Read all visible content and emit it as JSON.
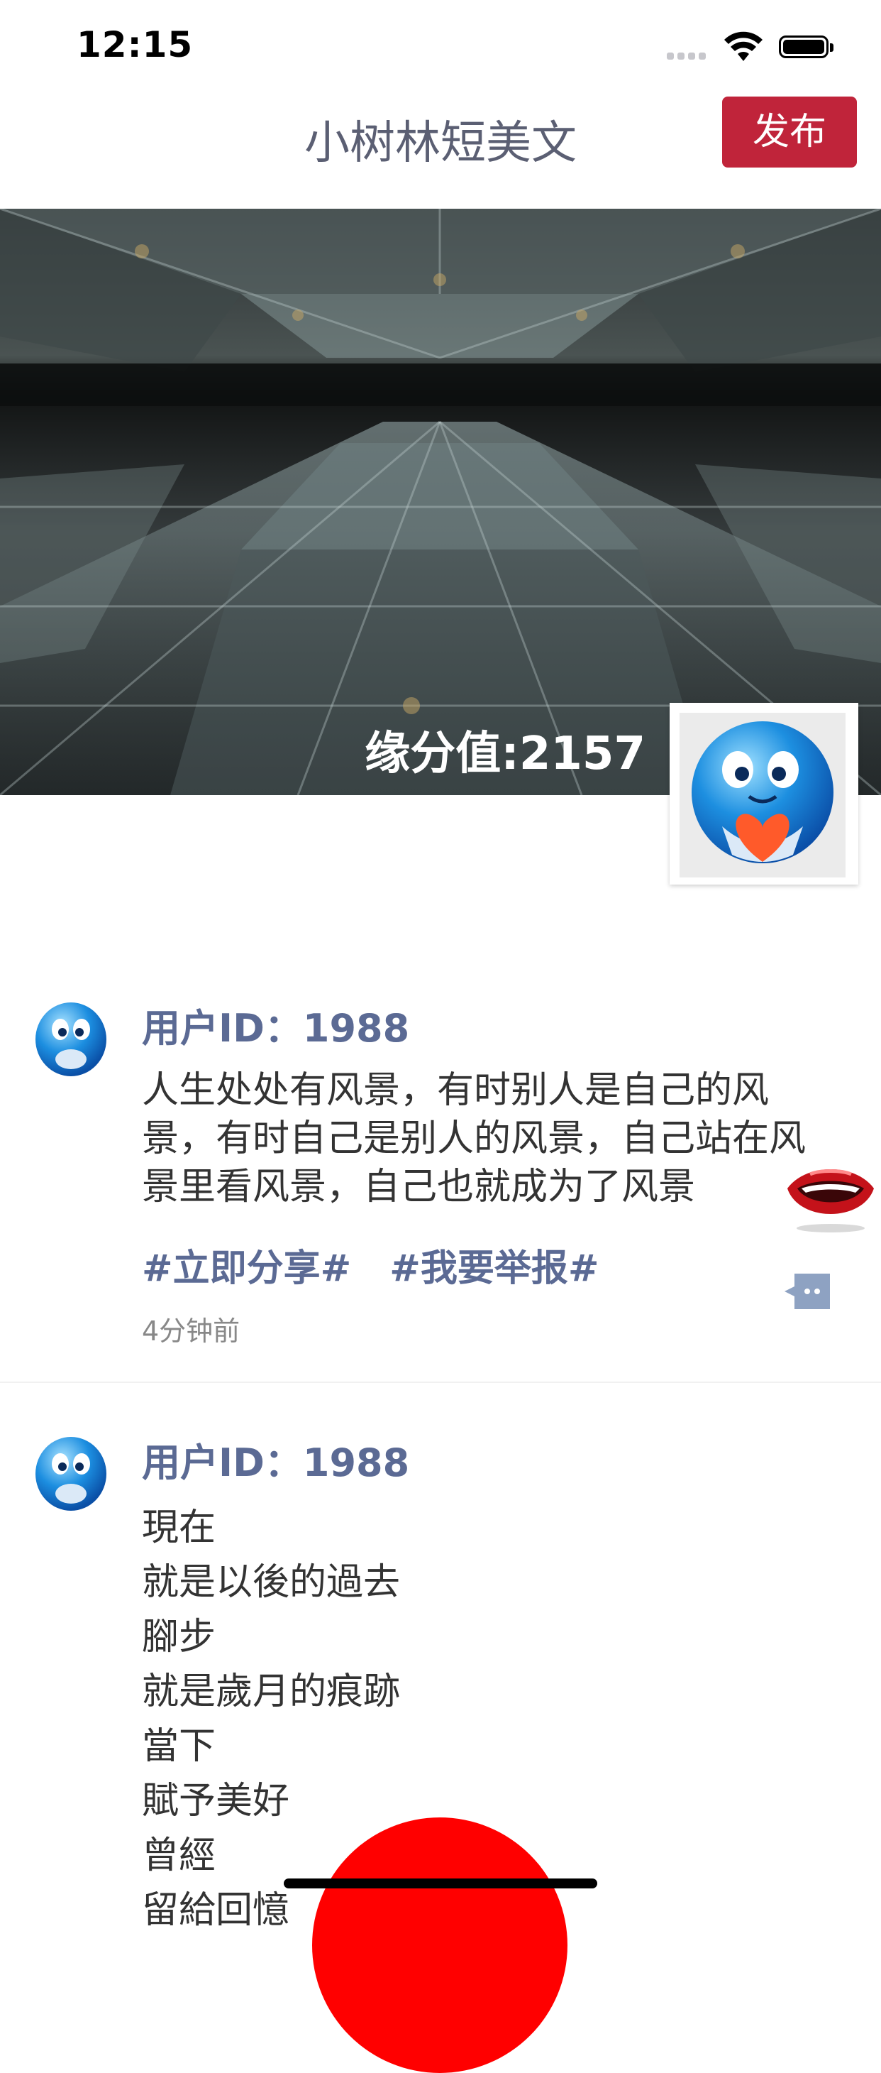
{
  "status_bar": {
    "time": "12:15"
  },
  "nav": {
    "title": "小树林短美文",
    "publish_label": "发布"
  },
  "header": {
    "fate_value": "缘分值:2157"
  },
  "posts": [
    {
      "user_id": "用户ID：1988",
      "text": "人生处处有风景，有时别人是自己的风景，有时自己是别人的风景，自己站在风景里看风景，自己也就成为了风景",
      "tags": [
        "#立即分享#",
        "#我要举报#"
      ],
      "time": "4分钟前"
    },
    {
      "user_id": "用户ID：1988",
      "lines": [
        "現在",
        "就是以後的過去",
        "腳步",
        "就是歲月的痕跡",
        "當下",
        "賦予美好",
        "曾經",
        "留給回憶"
      ]
    }
  ],
  "colors": {
    "accent_blue": "#5b6a94",
    "publish_red": "#c0243a",
    "title_gray": "#5b5f73"
  },
  "icons": [
    "signal-icon",
    "wifi-icon",
    "battery-icon",
    "comment-icon",
    "lips-icon",
    "emoji-avatar-icon"
  ]
}
